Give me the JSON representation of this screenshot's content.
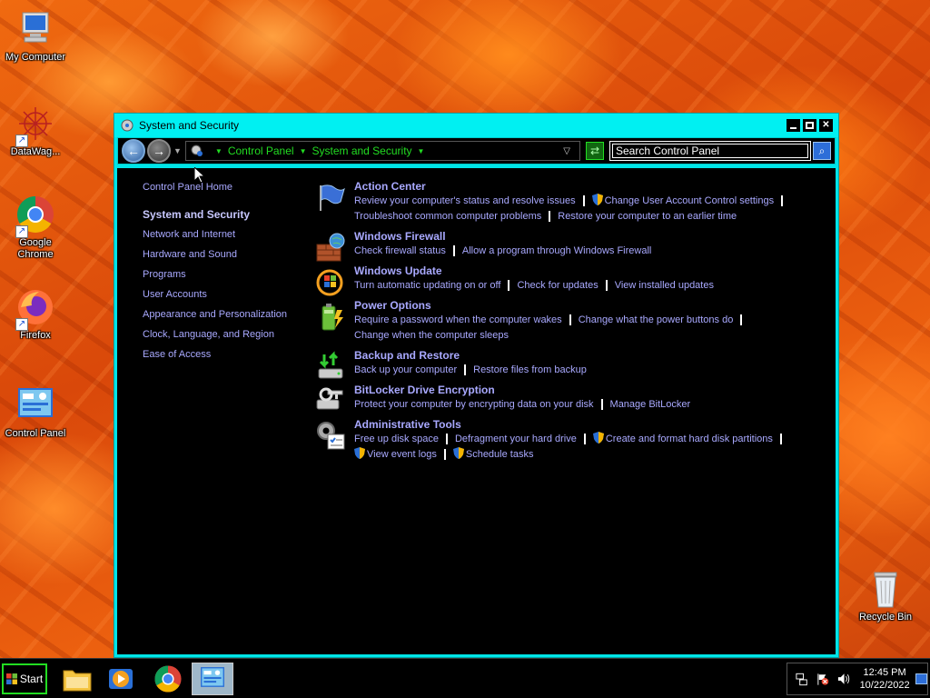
{
  "desktop": {
    "icons": [
      {
        "label": "My Computer",
        "icon": "computer-icon"
      },
      {
        "label": "DataWag...",
        "icon": "datawag-icon"
      },
      {
        "label": "Google Chrome",
        "icon": "chrome-icon"
      },
      {
        "label": "Firefox",
        "icon": "firefox-icon"
      },
      {
        "label": "Control Panel",
        "icon": "control-panel-icon"
      },
      {
        "label": "Recycle Bin",
        "icon": "recycle-bin-icon"
      }
    ]
  },
  "window": {
    "title": "System and Security",
    "controls": {
      "minimize": "minimize",
      "maximize": "maximize",
      "close": "✕"
    }
  },
  "addressbar": {
    "breadcrumbs": [
      "Control Panel",
      "System and Security"
    ],
    "search_placeholder": "Search Control Panel"
  },
  "leftnav": {
    "home": "Control Panel Home",
    "items": [
      {
        "label": "System and Security",
        "current": true
      },
      {
        "label": "Network and Internet"
      },
      {
        "label": "Hardware and Sound"
      },
      {
        "label": "Programs"
      },
      {
        "label": "User Accounts"
      },
      {
        "label": "Appearance and Personalization"
      },
      {
        "label": "Clock, Language, and Region"
      },
      {
        "label": "Ease of Access"
      }
    ]
  },
  "categories": {
    "action_center": {
      "title": "Action Center",
      "links": [
        "Review your computer's status and resolve issues",
        "Change User Account Control settings",
        "Troubleshoot common computer problems",
        "Restore your computer to an earlier time"
      ]
    },
    "firewall": {
      "title": "Windows Firewall",
      "links": [
        "Check firewall status",
        "Allow a program through Windows Firewall"
      ]
    },
    "update": {
      "title": "Windows Update",
      "links": [
        "Turn automatic updating on or off",
        "Check for updates",
        "View installed updates"
      ]
    },
    "power": {
      "title": "Power Options",
      "links": [
        "Require a password when the computer wakes",
        "Change what the power buttons do",
        "Change when the computer sleeps"
      ]
    },
    "backup": {
      "title": "Backup and Restore",
      "links": [
        "Back up your computer",
        "Restore files from backup"
      ]
    },
    "bitlocker": {
      "title": "BitLocker Drive Encryption",
      "links": [
        "Protect your computer by encrypting data on your disk",
        "Manage BitLocker"
      ]
    },
    "admin": {
      "title": "Administrative Tools",
      "links": [
        "Free up disk space",
        "Defragment your hard drive",
        "Create and format hard disk partitions",
        "View event logs",
        "Schedule tasks"
      ]
    }
  },
  "taskbar": {
    "start_label": "Start",
    "apps": [
      "file-explorer-icon",
      "media-player-icon",
      "chrome-icon",
      "control-panel-icon"
    ],
    "clock_time": "12:45 PM",
    "clock_date": "10/22/2022"
  },
  "colors": {
    "titlebar": "#00f0f2",
    "link": "#a9a9ff",
    "breadcrumb": "#22dd22",
    "start_border": "#22dd22"
  }
}
